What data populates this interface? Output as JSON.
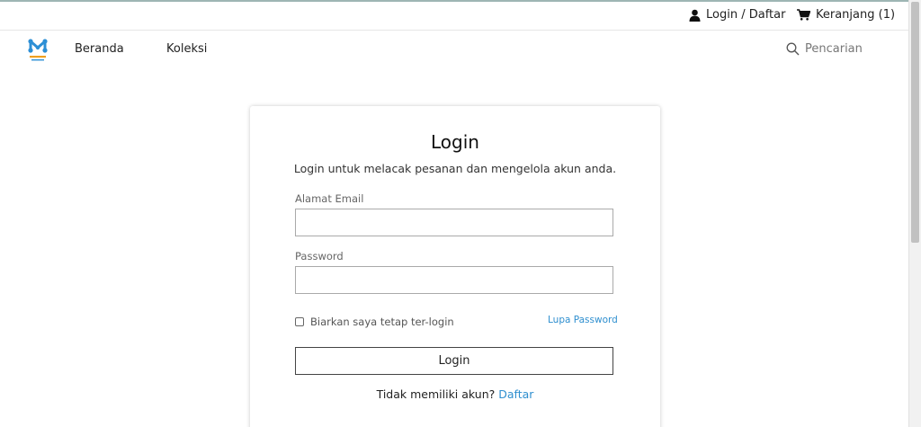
{
  "topbar": {
    "login_label": "Login / Daftar",
    "cart_label": "Keranjang (1)"
  },
  "nav": {
    "items": [
      {
        "label": "Beranda"
      },
      {
        "label": "Koleksi"
      }
    ],
    "search_placeholder": "Pencarian"
  },
  "login": {
    "title": "Login",
    "subtitle": "Login untuk melacak pesanan dan mengelola akun anda.",
    "email_label": "Alamat Email",
    "email_value": "",
    "password_label": "Password",
    "password_value": "",
    "remember_label": "Biarkan saya tetap ter-login",
    "remember_checked": false,
    "forgot_label": "Lupa Password",
    "button_label": "Login",
    "signup_prompt": "Tidak memiliki akun?",
    "signup_link": "Daftar"
  },
  "colors": {
    "link": "#2f8fcf",
    "logo": "#2d8fd5",
    "logo_accent": "#f0a020",
    "top_border": "#9eb6b4"
  },
  "icons": {
    "login": "user-icon",
    "cart": "cart-icon",
    "search": "search-icon",
    "logo": "brand-logo"
  }
}
